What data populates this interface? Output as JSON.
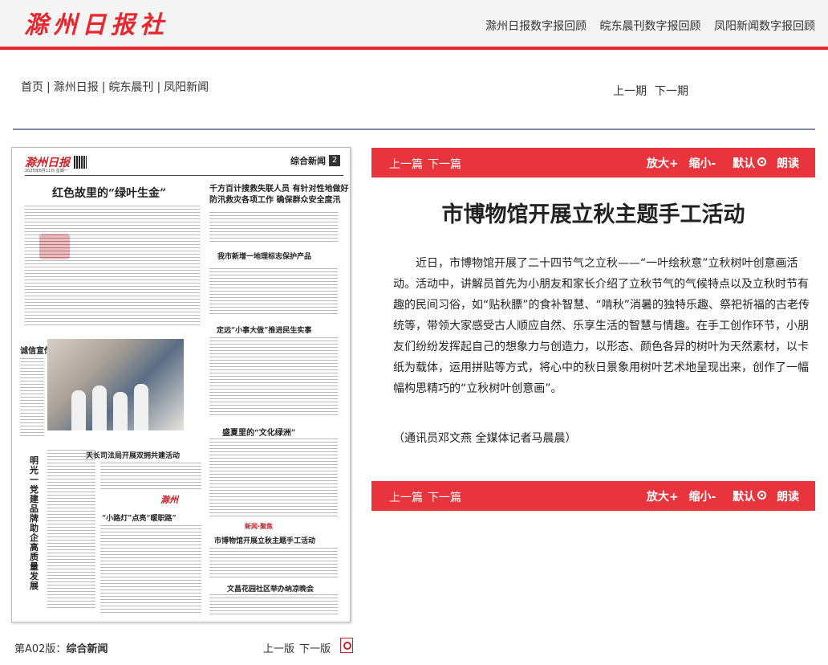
{
  "header": {
    "logo": "滁州日报社",
    "links": [
      "滁州日报数字报回顾",
      "皖东晨刊数字报回顾",
      "凤阳新闻数字报回顾"
    ]
  },
  "nav": {
    "items": [
      "首页",
      "滁州日报",
      "皖东晨刊",
      "凤阳新闻"
    ],
    "separator": "|",
    "prev_issue": "上一期",
    "next_issue": "下一期"
  },
  "newspaper": {
    "logo": "滁州日报",
    "date": "2025年8月11日 星期一",
    "section": "综合新闻",
    "page_no": "2",
    "headlines": {
      "h1": "红色故里的“绿叶生金”",
      "h2a": "千方百计搜救失联人员 有针对性地做好",
      "h2b": "防汛救灾各项工作 确保群众安全度汛",
      "h3": "我市新增一地理标志保护产品",
      "h4": "定远“小事大做”推进民生实事",
      "h5": "诚信宣传进基层",
      "h6": "盛夏里的“文化绿洲”",
      "h7": "天长司法局开展双拥共建活动",
      "h8": "“小路灯”点亮“暖职路”",
      "h9": "市博物馆开展立秋主题手工活动",
      "h10": "文昌花园社区举办纳凉晚会",
      "vertical": "明光一党建品牌助企高质量发展",
      "brand": "滁州",
      "tag": "新闻·聚焦"
    }
  },
  "page_footer": {
    "edition_prefix": "第A02版：",
    "edition_name": "综合新闻",
    "prev_page": "上一版",
    "next_page": "下一版",
    "pdf_icon": "pdf-icon"
  },
  "toolbar": {
    "prev_article": "上一篇",
    "next_article": "下一篇",
    "zoom_in": "放大+",
    "zoom_out": "缩小-",
    "default": "默认",
    "read": "朗读"
  },
  "article": {
    "title": "市博物馆开展立秋主题手工活动",
    "body": "近日，市博物馆开展了二十四节气之立秋——“一叶绘秋意”立秋树叶创意画活动。活动中，讲解员首先为小朋友和家长介绍了立秋节气的气候特点以及立秋时节有趣的民间习俗，如“贴秋膘”的食补智慧、“啃秋”消暑的独特乐趣、祭祀祈福的古老传统等，带领大家感受古人顺应自然、乐享生活的智慧与情趣。在手工创作环节，小朋友们纷纷发挥起自己的想象力与创造力，以形态、颜色各异的树叶为天然素材，以卡纸为载体，运用拼贴等方式，将心中的秋日景象用树叶艺术地呈现出来，创作了一幅幅构思精巧的“立秋树叶创意画”。",
    "credit": "（通讯员邓文燕 全媒体记者马晨晨）"
  },
  "colors": {
    "brand_red": "#e8353d",
    "logo_red": "#e8262d",
    "rule_blue": "#7d8aa8"
  }
}
